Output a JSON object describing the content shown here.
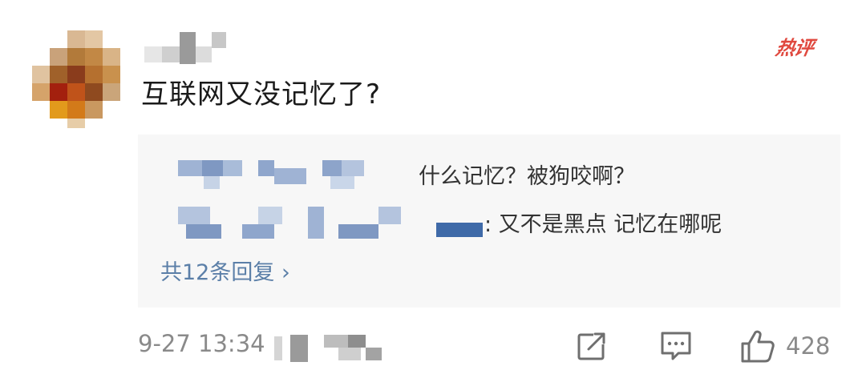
{
  "comment": {
    "hot_badge": "热评",
    "text": "互联网又没记忆了?",
    "timestamp": "9-27 13:34",
    "like_count": "428"
  },
  "replies": [
    {
      "text": "什么记忆？被狗咬啊？"
    },
    {
      "text": ": 又不是黑点 记忆在哪呢"
    }
  ],
  "more_replies_label": "共12条回复 ›",
  "icons": {
    "share": "share-icon",
    "comment": "comment-icon",
    "like": "thumbs-up-icon"
  },
  "colors": {
    "hot_badge": "#e0493f",
    "link": "#5b7fa8",
    "reply_bg": "#f7f7f7",
    "meta_text": "#8a8a8a"
  }
}
